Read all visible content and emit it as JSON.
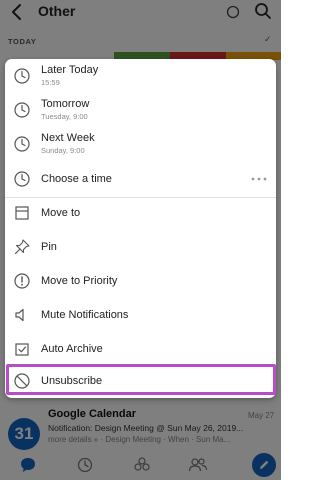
{
  "header": {
    "title": "Other"
  },
  "section": {
    "label": "TODAY"
  },
  "colors": {
    "accent": "#1565c0",
    "highlight": "#b84cc9",
    "strip_green": "#5fa342",
    "strip_red": "#d32f2f",
    "strip_orange": "#f2a30f"
  },
  "menu": {
    "later_today": {
      "label": "Later Today",
      "sub": "15:59"
    },
    "tomorrow": {
      "label": "Tomorrow",
      "sub": "Tuesday, 9:00"
    },
    "next_week": {
      "label": "Next Week",
      "sub": "Sunday, 9:00"
    },
    "choose_time": {
      "label": "Choose a time"
    },
    "move_to": {
      "label": "Move to"
    },
    "pin": {
      "label": "Pin"
    },
    "move_to_priority": {
      "label": "Move to Priority"
    },
    "mute": {
      "label": "Mute Notifications"
    },
    "auto_archive": {
      "label": "Auto Archive"
    },
    "unsubscribe": {
      "label": "Unsubscribe"
    }
  },
  "email": {
    "avatar_text": "31",
    "sender": "Google Calendar",
    "date": "May 27",
    "subject": "Notification: Design Meeting @ Sun May 26, 2019...",
    "preview": "more details » · Design Meeting · When · Sun Ma..."
  },
  "icons": [
    "back-icon",
    "search-icon",
    "clock-icon",
    "folder-icon",
    "pin-icon",
    "priority-icon",
    "mute-icon",
    "archive-icon",
    "block-icon",
    "mail-icon",
    "calendar-icon",
    "files-icon",
    "people-icon",
    "pencil-icon"
  ]
}
